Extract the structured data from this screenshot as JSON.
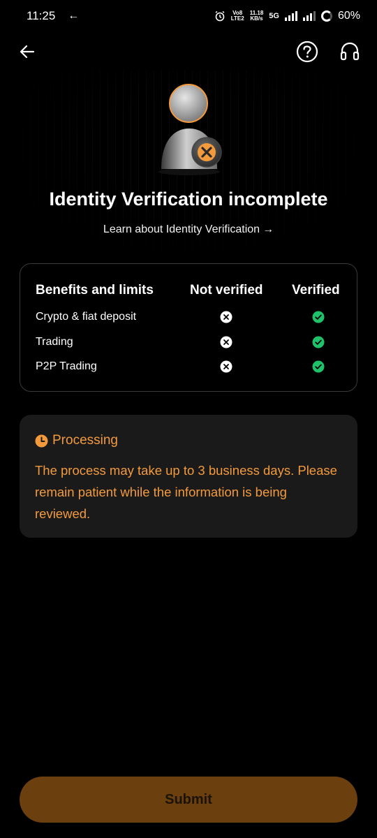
{
  "status_bar": {
    "time": "11:25",
    "back_arrow": "←",
    "volte_top": "Vo8",
    "volte_bottom": "LTE2",
    "speed_top": "11.18",
    "speed_bottom": "KB/s",
    "network": "5G",
    "battery": "60%"
  },
  "top_bar": {
    "back_icon": "arrow-left-icon",
    "help_icon": "question-circle-icon",
    "support_icon": "headset-icon"
  },
  "hero": {
    "illustration": "user-with-x-badge-icon",
    "title": "Identity Verification incomplete",
    "link_text": "Learn about Identity Verification",
    "link_arrow": "→"
  },
  "benefits": {
    "headers": {
      "label": "Benefits and limits",
      "not_verified": "Not verified",
      "verified": "Verified"
    },
    "rows": [
      {
        "label": "Crypto & fiat deposit",
        "not_verified": "x-circle-icon",
        "verified": "check-circle-icon"
      },
      {
        "label": "Trading",
        "not_verified": "x-circle-icon",
        "verified": "check-circle-icon"
      },
      {
        "label": "P2P Trading",
        "not_verified": "x-circle-icon",
        "verified": "check-circle-icon"
      }
    ]
  },
  "processing": {
    "icon": "clock-icon",
    "title": "Processing",
    "message": "The process may take up to 3 business days. Please remain patient while the information is being reviewed."
  },
  "submit": {
    "label": "Submit"
  },
  "colors": {
    "background": "#000000",
    "accent_orange": "#f39a3d",
    "success_green": "#1fc16b",
    "submit_bg": "#6b3f0e",
    "card_bg": "#1a1a1a"
  }
}
